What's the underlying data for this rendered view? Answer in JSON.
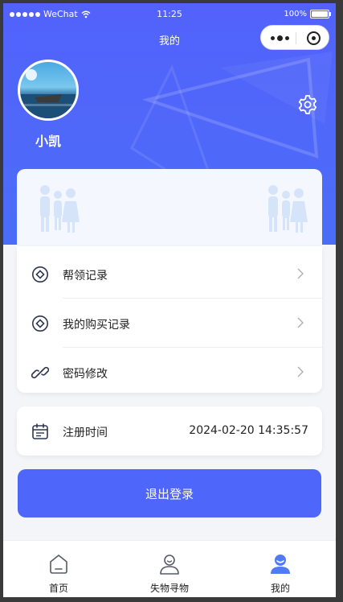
{
  "status_bar": {
    "carrier": "WeChat",
    "time": "11:25",
    "battery": "100%"
  },
  "nav": {
    "title": "我的"
  },
  "profile": {
    "username": "小凯"
  },
  "menu": {
    "items": [
      {
        "label": "帮领记录",
        "icon": "diamond-circle-icon"
      },
      {
        "label": "我的购买记录",
        "icon": "diamond-circle-icon"
      },
      {
        "label": "密码修改",
        "icon": "link-icon"
      }
    ]
  },
  "registration": {
    "label": "注册时间",
    "value": "2024-02-20 14:35:57",
    "icon": "calendar-icon"
  },
  "logout": {
    "label": "退出登录"
  },
  "tabbar": {
    "items": [
      {
        "label": "首页",
        "icon": "home-icon"
      },
      {
        "label": "失物寻物",
        "icon": "person-smile-icon"
      },
      {
        "label": "我的",
        "icon": "user-filled-icon",
        "active": true
      }
    ]
  },
  "colors": {
    "primary": "#4f66fb",
    "hero_start": "#5262fb",
    "hero_end": "#4a6df8",
    "icon_active": "#4f7cf5"
  }
}
